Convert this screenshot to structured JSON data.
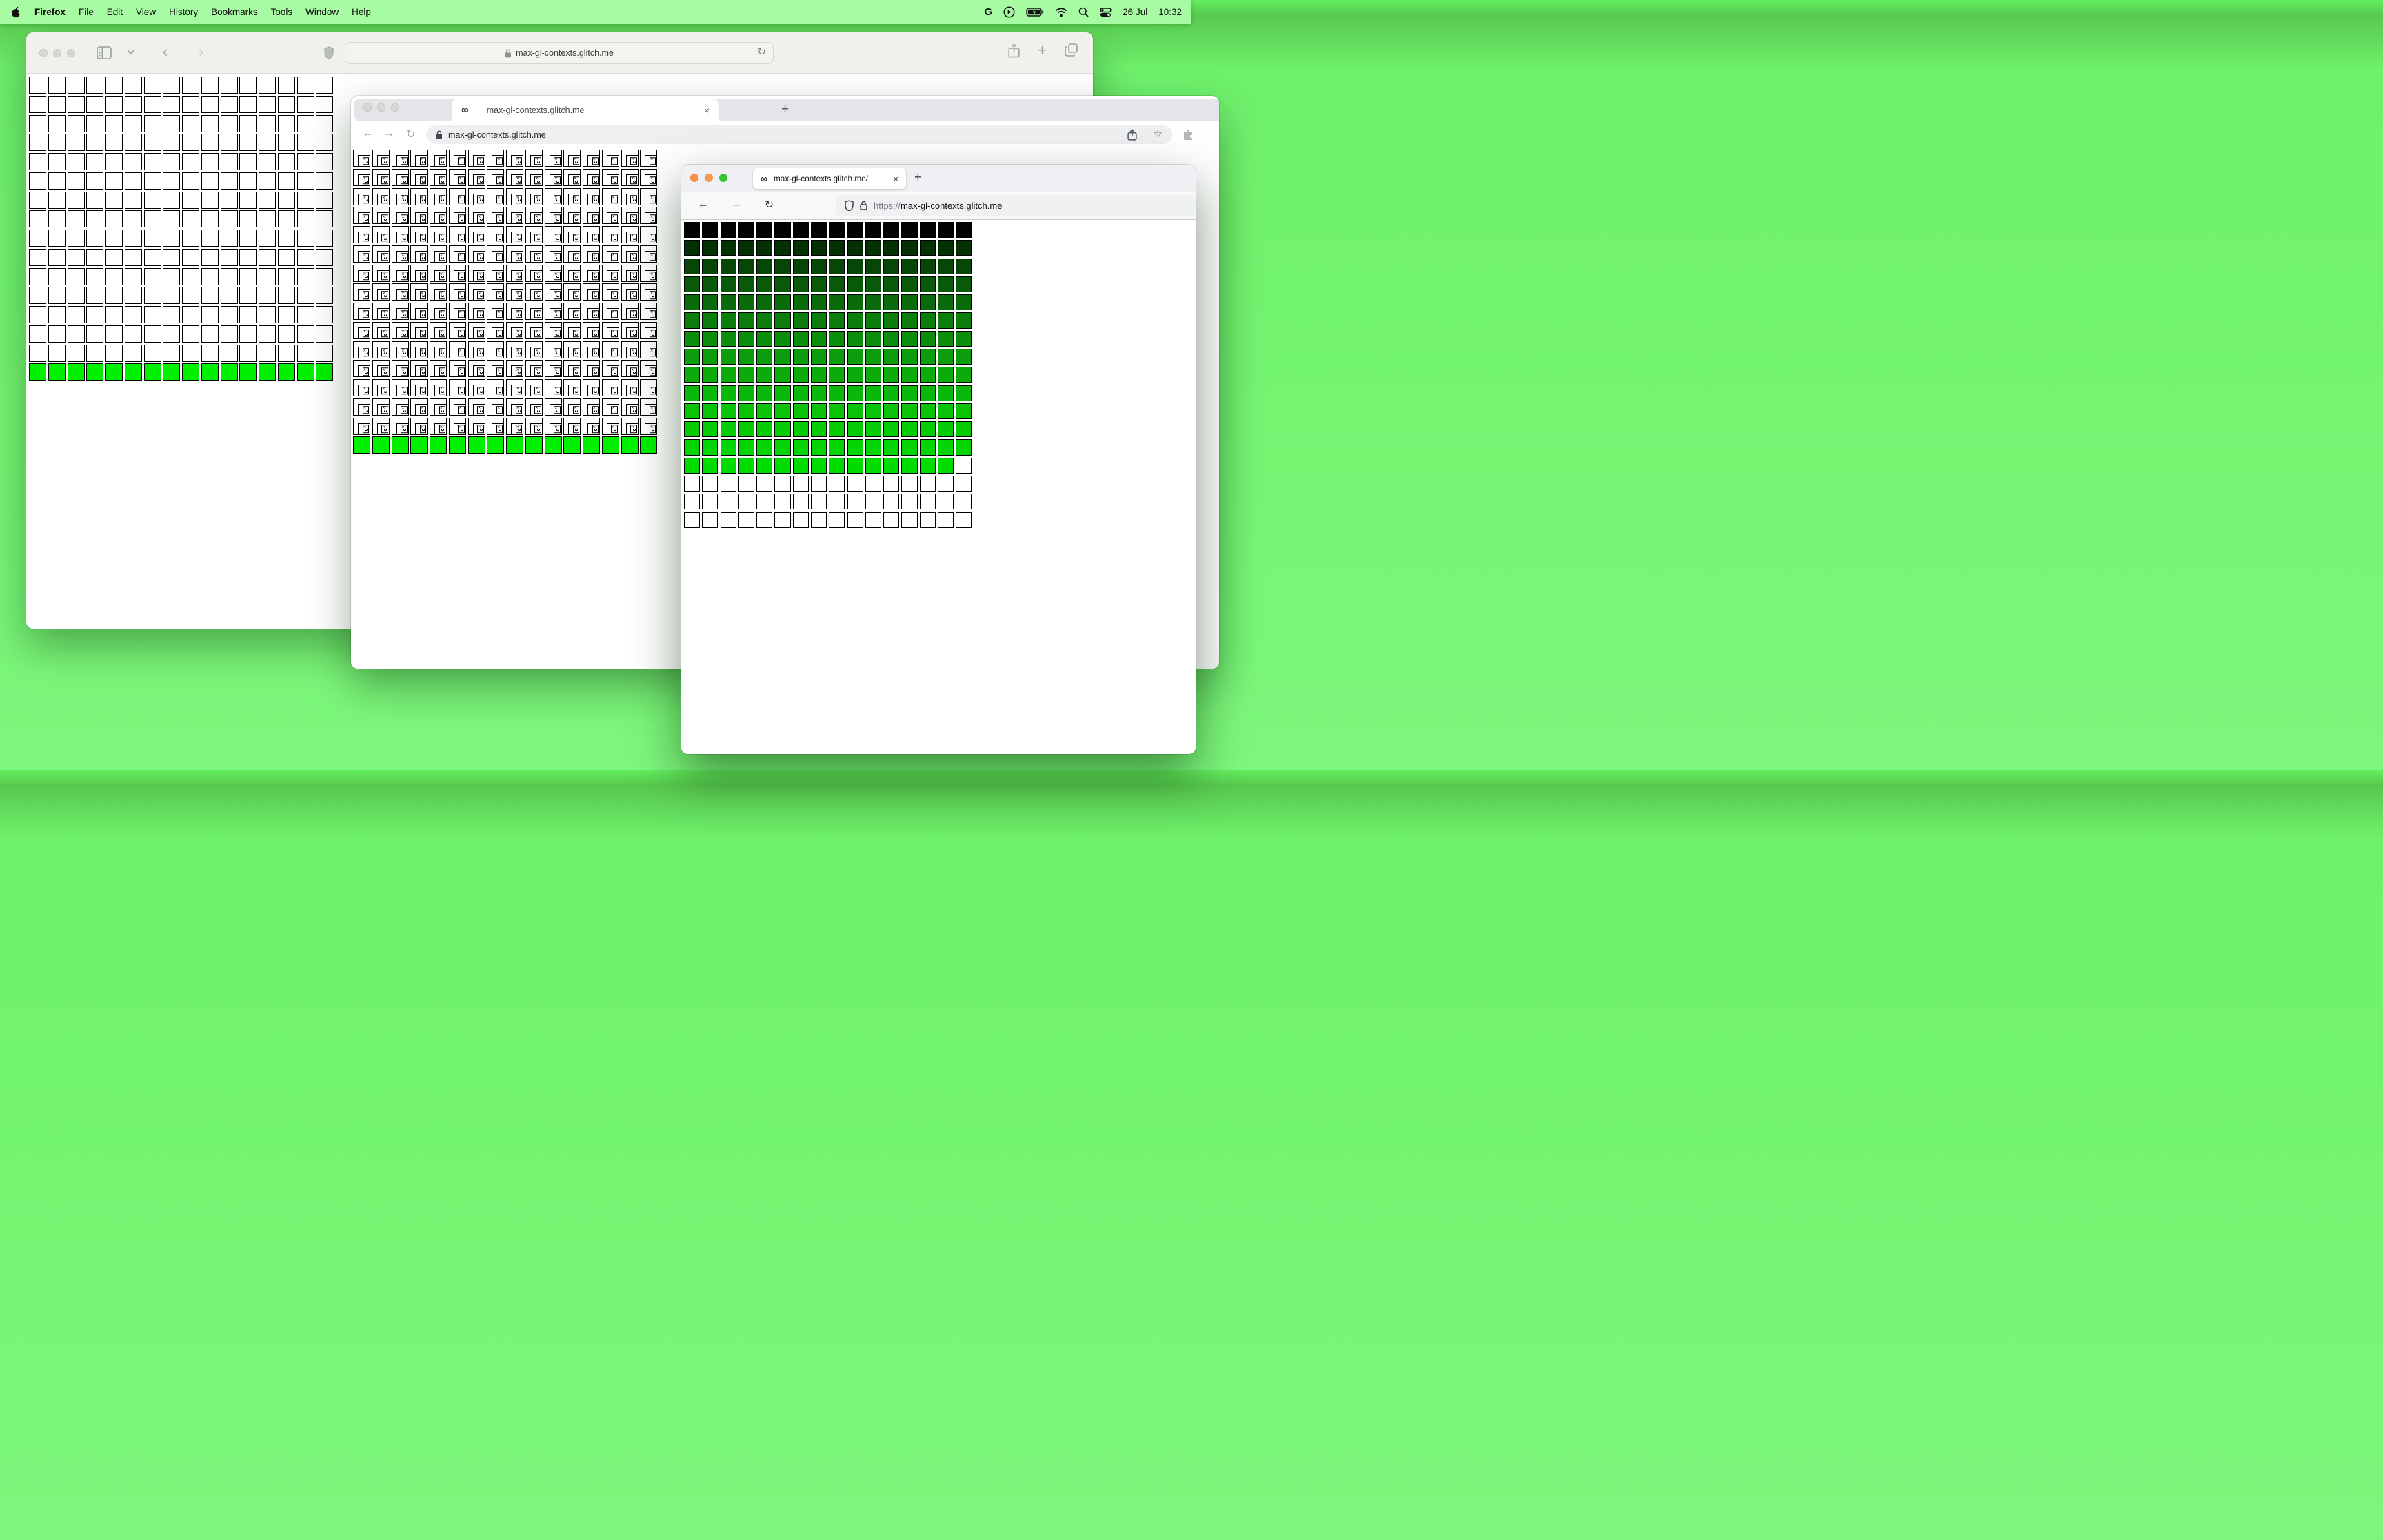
{
  "menu_bar": {
    "app_name": "Firefox",
    "menus": [
      "File",
      "Edit",
      "View",
      "History",
      "Bookmarks",
      "Tools",
      "Window",
      "Help"
    ],
    "status": {
      "google_glyph": "G",
      "date": "26 Jul",
      "time": "10:32"
    }
  },
  "safari": {
    "url": "max-gl-contexts.glitch.me",
    "back_glyph": "‹",
    "forward_glyph": "›",
    "reload_glyph": "↻",
    "new_tab_glyph": "+"
  },
  "chrome": {
    "tab_title": "max-gl-contexts.glitch.me",
    "url": "max-gl-contexts.glitch.me",
    "favicon_glyph": "∞",
    "close_glyph": "×",
    "new_tab_glyph": "+",
    "back_glyph": "←",
    "forward_glyph": "→",
    "reload_glyph": "↻",
    "star_glyph": "☆"
  },
  "firefox": {
    "tab_title": "max-gl-contexts.glitch.me/",
    "url_scheme": "https://",
    "url_host": "max-gl-contexts.glitch.me",
    "favicon_glyph": "∞",
    "close_glyph": "×",
    "new_tab_glyph": "+",
    "back_glyph": "←",
    "forward_glyph": "→",
    "reload_glyph": "↻"
  },
  "grids": {
    "safari": {
      "style": "plain",
      "columns": 16,
      "rows": 16,
      "body_color": "#ffffff",
      "final_row_color": "#00f000"
    },
    "chrome": {
      "style": "broken",
      "columns": 16,
      "rows": 16,
      "body_color": "#ffffff",
      "final_row_color": "#00f000"
    },
    "firefox": {
      "style": "colors",
      "columns": 16,
      "row_colors": [
        "#020202",
        "#043004",
        "#064606",
        "#085908",
        "#096b09",
        "#0a7d0a",
        "#0b8e0b",
        "#0b9d0b",
        "#0cab0c",
        "#0ab80a",
        "#08c308",
        "#06cc06",
        "#03d403",
        "#00db00",
        "#ffffff",
        "#ffffff",
        "#ffffff"
      ],
      "partial_row_index": 13,
      "partial_trailing_white": 1
    }
  },
  "colors": {
    "desktop": "#74f471",
    "green_cell": "#00f000",
    "menubar": "#a6fba3"
  }
}
